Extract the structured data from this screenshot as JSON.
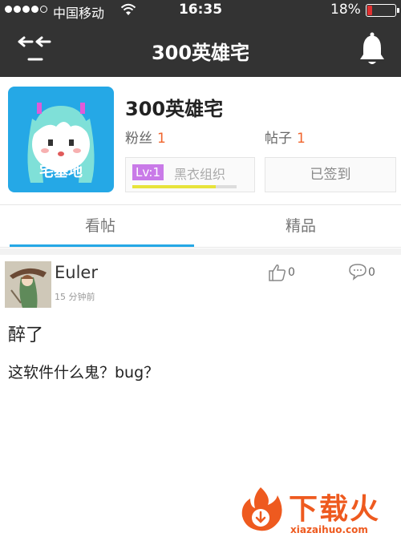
{
  "status_bar": {
    "carrier": "中国移动",
    "time": "16:35",
    "battery_text": "18%",
    "battery_level": 0.18,
    "signal_bars": 4
  },
  "nav": {
    "title": "300英雄宅",
    "back_icon": "back-arrows-icon",
    "bell_icon": "bell-icon"
  },
  "forum": {
    "name": "300英雄宅",
    "avatar_label": "宅基地",
    "fans_label": "粉丝",
    "fans_count": "1",
    "posts_label": "帖子",
    "posts_count": "1",
    "level_badge": "Lv:1",
    "level_title": "黑衣组织",
    "level_progress": 0.8,
    "signin_label": "已签到"
  },
  "tabs": [
    {
      "label": "看帖",
      "active": true
    },
    {
      "label": "精品",
      "active": false
    }
  ],
  "post": {
    "author": "Euler",
    "time": "15 分钟前",
    "likes": "0",
    "comments": "0",
    "title": "醉了",
    "body": "这软件什么鬼？bug？"
  },
  "watermark": {
    "text": "下载火",
    "url": "xiazaihuo.com"
  },
  "colors": {
    "bar_bg": "#333333",
    "accent_blue": "#25a8e6",
    "accent_orange": "#f0652d",
    "level_purple": "#c97ae8",
    "level_yellow": "#e7e33a",
    "battery_red": "#e03030"
  }
}
